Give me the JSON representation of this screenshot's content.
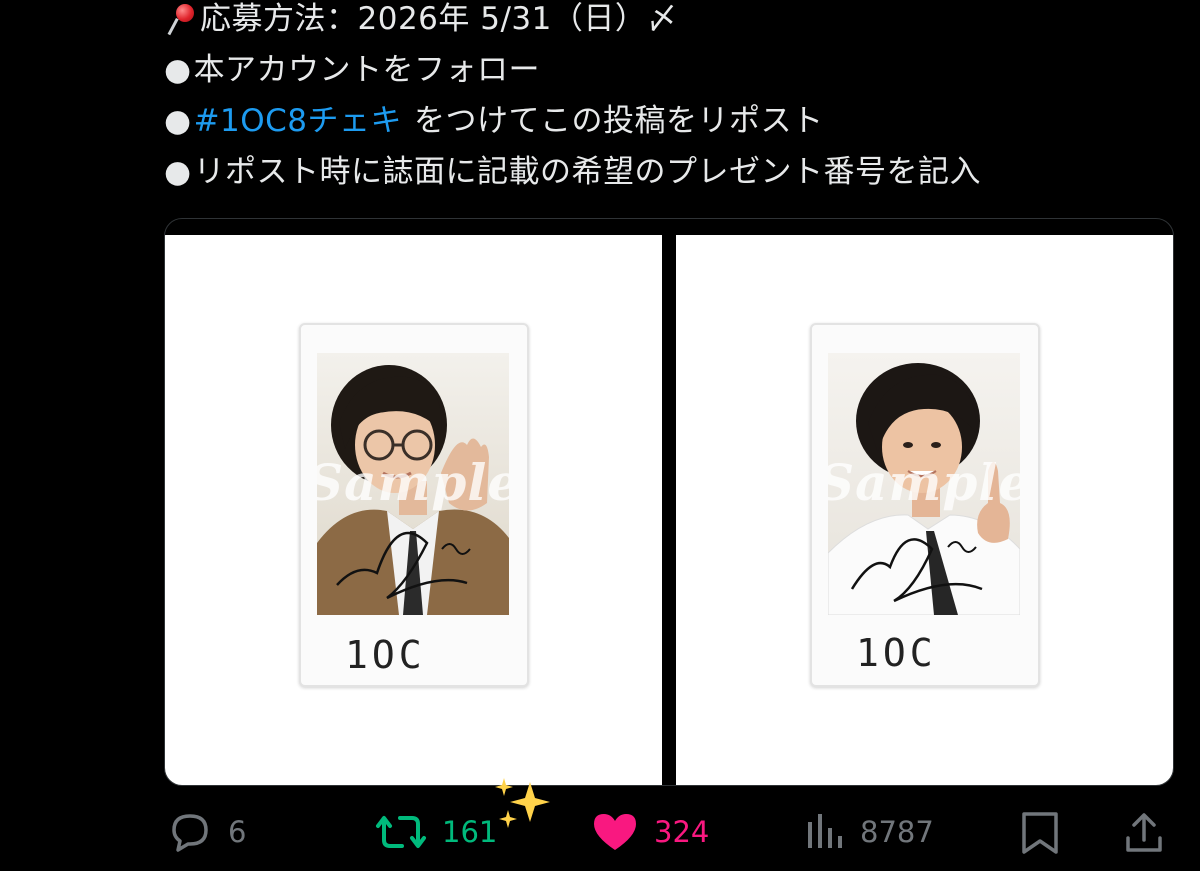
{
  "tweet": {
    "line1": "応募方法：2026年 5/31（日）〆",
    "line2": "本アカウントをフォロー",
    "line3_hashtag": "#1OC8チェキ",
    "line3_rest": "をつけてこの投稿をリポスト",
    "line4": "リポスト時に誌面に記載の希望のプレゼント番号を記入",
    "bullet": "●",
    "pin_icon": "round-pushpin-icon"
  },
  "media": {
    "images": [
      {
        "watermark": "Sample",
        "handwriting": "1OC"
      },
      {
        "watermark": "Sample",
        "handwriting": "1OC"
      }
    ]
  },
  "actions": {
    "reply_count": "6",
    "retweet_count": "161",
    "like_count": "324",
    "views_count": "8787",
    "colors": {
      "retweet": "#00ba7c",
      "like": "#f91880",
      "muted": "#71767b",
      "hashtag": "#1d9bf0"
    }
  }
}
